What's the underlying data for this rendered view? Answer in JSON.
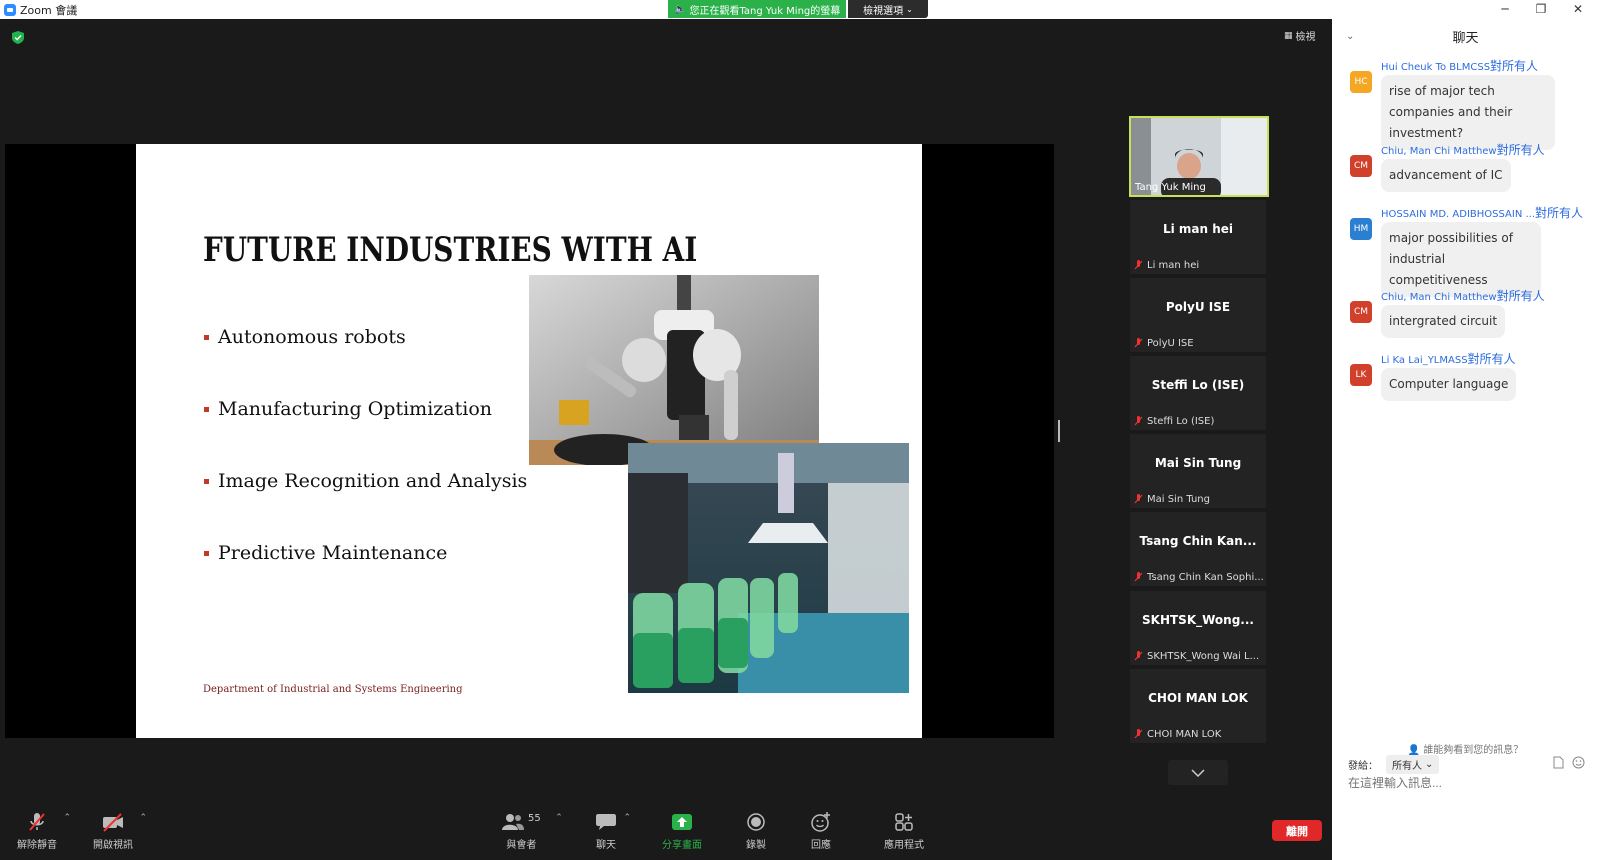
{
  "window": {
    "app_title": "Zoom 會議",
    "share_banner": "您正在觀看Tang Yuk Ming的螢幕",
    "view_options": "檢視選項"
  },
  "meeting": {
    "view_label": "檢視",
    "slide": {
      "title": "FUTURE INDUSTRIES WITH AI",
      "bullets": [
        "Autonomous robots",
        "Manufacturing Optimization",
        "Image Recognition and Analysis",
        "Predictive Maintenance"
      ],
      "footer": "Department of Industrial and Systems Engineering"
    },
    "active_speaker": "Tang Yuk Ming",
    "participants": [
      {
        "display": "Li man hei",
        "name": "Li man hei"
      },
      {
        "display": "PolyU ISE",
        "name": "PolyU ISE"
      },
      {
        "display": "Steffi Lo (ISE)",
        "name": "Steffi Lo (ISE)"
      },
      {
        "display": "Mai Sin Tung",
        "name": "Mai Sin Tung"
      },
      {
        "display": "Tsang Chin Kan...",
        "name": "Tsang Chin Kan Sophi..."
      },
      {
        "display": "SKHTSK_Wong...",
        "name": "SKHTSK_Wong Wai L..."
      },
      {
        "display": "CHOI MAN LOK",
        "name": "CHOI MAN LOK"
      }
    ]
  },
  "toolbar": {
    "unmute": "解除靜音",
    "start_video": "開啟視訊",
    "participants": "與會者",
    "participant_count": "55",
    "chat": "聊天",
    "share_screen": "分享畫面",
    "record": "錄製",
    "reactions": "回應",
    "apps": "應用程式",
    "end": "離開"
  },
  "chat": {
    "title": "聊天",
    "to_everyone": "對所有人",
    "messages": [
      {
        "initials": "HC",
        "color": "#f5a623",
        "sender": "Hui Cheuk To BLMCSS",
        "text": "rise of major tech companies and their investment?"
      },
      {
        "initials": "CM",
        "color": "#d0402b",
        "sender": "Chiu, Man Chi Matthew",
        "text": "advancement of IC"
      },
      {
        "initials": "HM",
        "color": "#2b7fd0",
        "sender": "HOSSAIN MD. ADIBHOSSAIN ...",
        "text": "major possibilities of industrial competitiveness"
      },
      {
        "initials": "CM",
        "color": "#d0402b",
        "sender": "Chiu, Man Chi Matthew",
        "text": "intergrated circuit"
      },
      {
        "initials": "LK",
        "color": "#d0402b",
        "sender": "Li Ka Lai_YLMASS",
        "text": "Computer language"
      }
    ],
    "who_can_see": "誰能夠看到您的訊息？",
    "send_to_label": "發給：",
    "send_to_value": "所有人",
    "input_placeholder": "在這裡輸入訊息..."
  }
}
